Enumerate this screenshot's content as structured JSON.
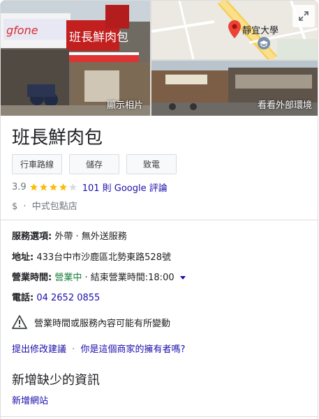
{
  "photos": {
    "show_photos_label": "顯示相片",
    "street_view_label": "看看外部環境",
    "map_place_label": "靜宜大學",
    "storefront_sign": "班長鮮肉包"
  },
  "place": {
    "name": "班長鮮肉包"
  },
  "actions": {
    "directions": "行車路線",
    "save": "儲存",
    "call": "致電"
  },
  "rating": {
    "value": "3.9",
    "stars": 3.9,
    "reviews_text": "101 則 Google 評論"
  },
  "meta": {
    "price": "$",
    "separator": "·",
    "category": "中式包點店"
  },
  "details": {
    "service_label": "服務選項:",
    "service_value": "外帶 · 無外送服務",
    "address_label": "地址:",
    "address_value": "433台中市沙鹿區北勢東路528號",
    "hours_label": "營業時間:",
    "hours_status": "營業中",
    "hours_detail": "· 結束營業時間:18:00",
    "phone_label": "電話:",
    "phone_value": "04 2652 0855"
  },
  "notice": {
    "text": "營業時間或服務內容可能有所變動"
  },
  "suggest": {
    "edit": "提出修改建議",
    "separator": "·",
    "owner": "你是這個商家的擁有者嗎?"
  },
  "missing": {
    "title": "新增缺少的資訊",
    "add_website": "新增網站"
  },
  "colors": {
    "link": "#1a0dab",
    "open_green": "#188038",
    "star": "#fbbc04",
    "pin": "#ea4335"
  }
}
